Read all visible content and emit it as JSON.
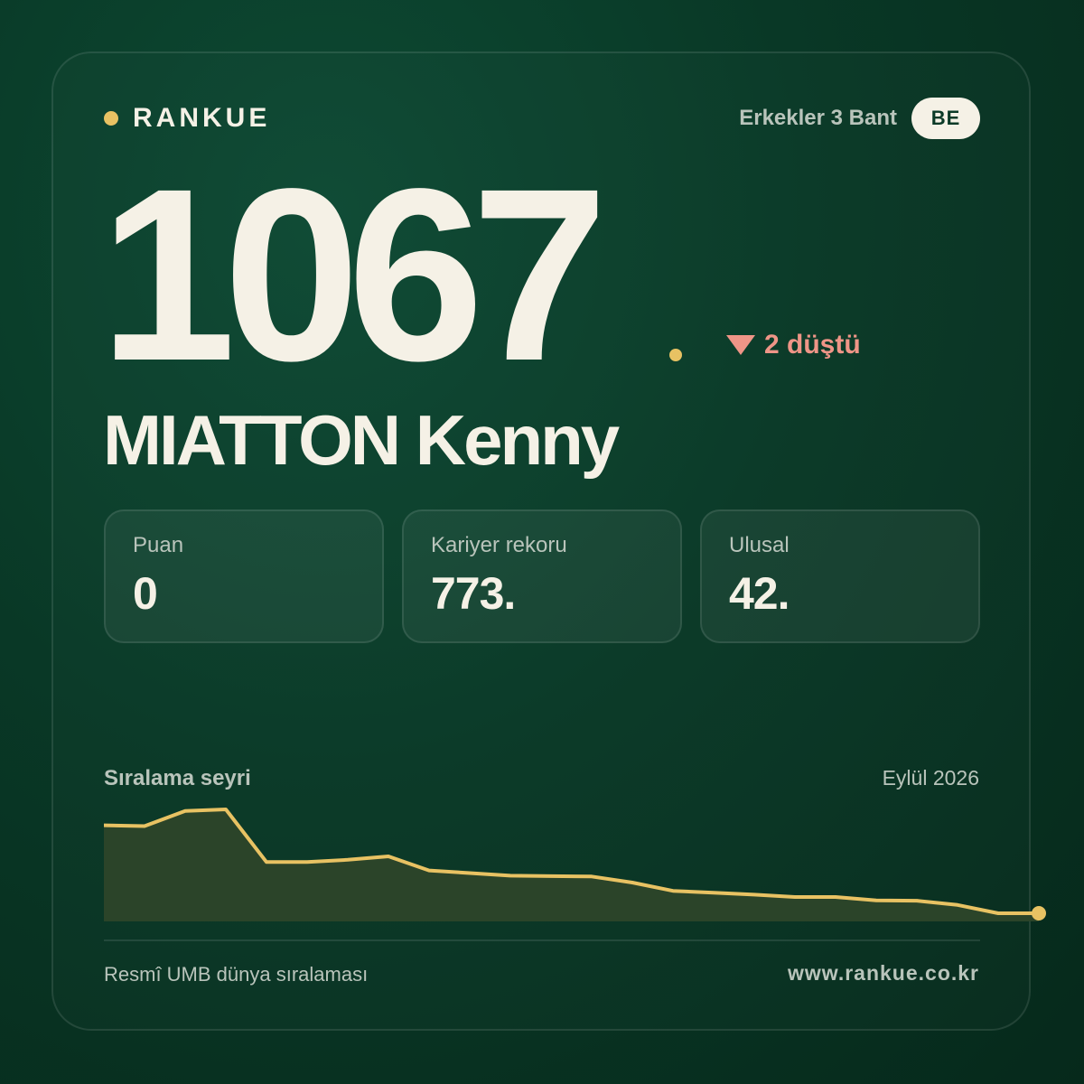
{
  "brand": {
    "name": "RANKUE"
  },
  "header": {
    "category": "Erkekler 3 Bant",
    "country_code": "BE"
  },
  "rank": {
    "value": "1067",
    "change_text": "2 düştü",
    "direction": "down"
  },
  "player": {
    "name": "MIATTON Kenny"
  },
  "stats": [
    {
      "label": "Puan",
      "value": "0"
    },
    {
      "label": "Kariyer rekoru",
      "value": "773."
    },
    {
      "label": "Ulusal",
      "value": "42."
    }
  ],
  "chart_data": {
    "type": "area",
    "title": "Sıralama seyri",
    "period_label": "Eylül 2026",
    "axis_label_x": "",
    "axis_label_y": "",
    "y_inverted": true,
    "values": [
      812,
      814,
      774,
      770,
      909,
      909,
      903,
      894,
      931,
      938,
      945,
      946,
      947,
      963,
      985,
      990,
      995,
      1001,
      1001,
      1010,
      1011,
      1022,
      1044,
      1044
    ],
    "last_index_marked": true,
    "colors": {
      "line": "#e8c263",
      "fill": "#2b4429"
    }
  },
  "footer": {
    "source": "Resmî UMB dünya sıralaması",
    "url": "www.rankue.co.kr"
  },
  "colors": {
    "accent": "#e8c263",
    "decline": "#ef9587",
    "text": "#f5f1e6",
    "muted": "#b9c4bb"
  }
}
